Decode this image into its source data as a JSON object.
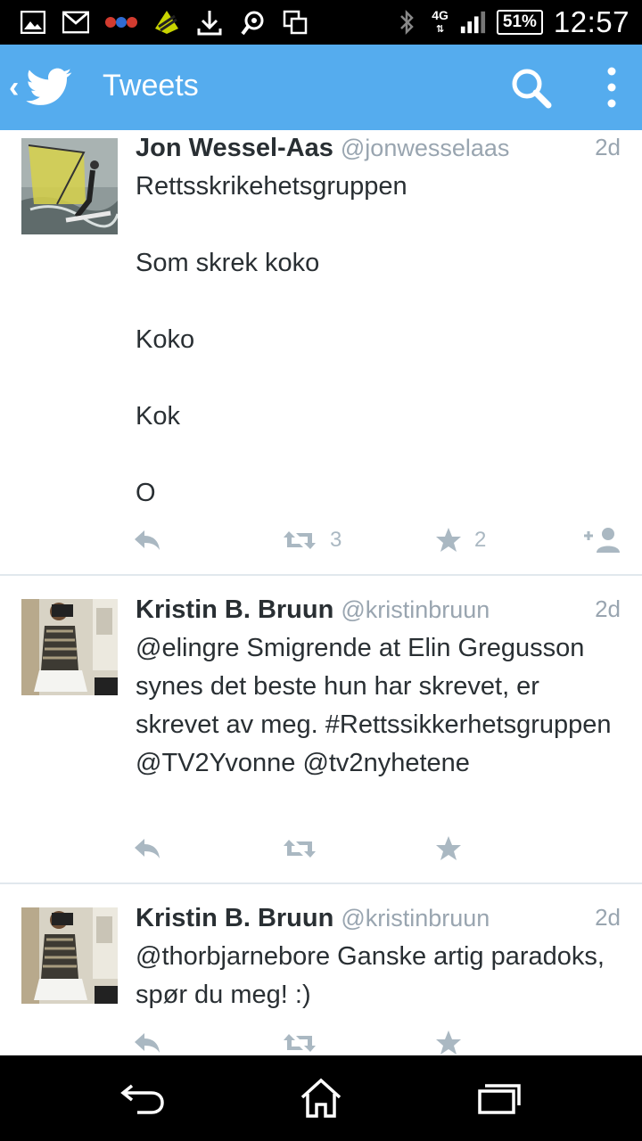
{
  "status_bar": {
    "left_icons": [
      "gallery-icon",
      "gmail-icon",
      "fmt-icon",
      "app-icon",
      "download-icon",
      "sync-icon",
      "screenshot-icon"
    ],
    "fmt_label": "FMT",
    "network": "4G",
    "battery": "51%",
    "time": "12:57"
  },
  "app_bar": {
    "title": "Tweets",
    "brand_color": "#55acee"
  },
  "tweets": [
    {
      "name": "Jon Wessel-Aas",
      "handle": "@jonwesselaas",
      "time": "2d",
      "text": "Rettsskrikehetsgruppen\n\nSom skrek koko\n\nKoko\n\nKok\n\nO",
      "retweets": "3",
      "favorites": "2"
    },
    {
      "name": "Kristin B. Bruun",
      "handle": "@kristinbruun",
      "time": "2d",
      "text": "@elingre Smigrende at Elin Gregusson synes det beste hun har skrevet, er skrevet av meg. #Rettssikkerhetsgruppen @TV2Yvonne @tv2nyhetene"
    },
    {
      "name": "Kristin B. Bruun",
      "handle": "@kristinbruun",
      "time": "2d",
      "text": "@thorbjarnebore Ganske artig paradoks, spør du meg! :)"
    }
  ]
}
